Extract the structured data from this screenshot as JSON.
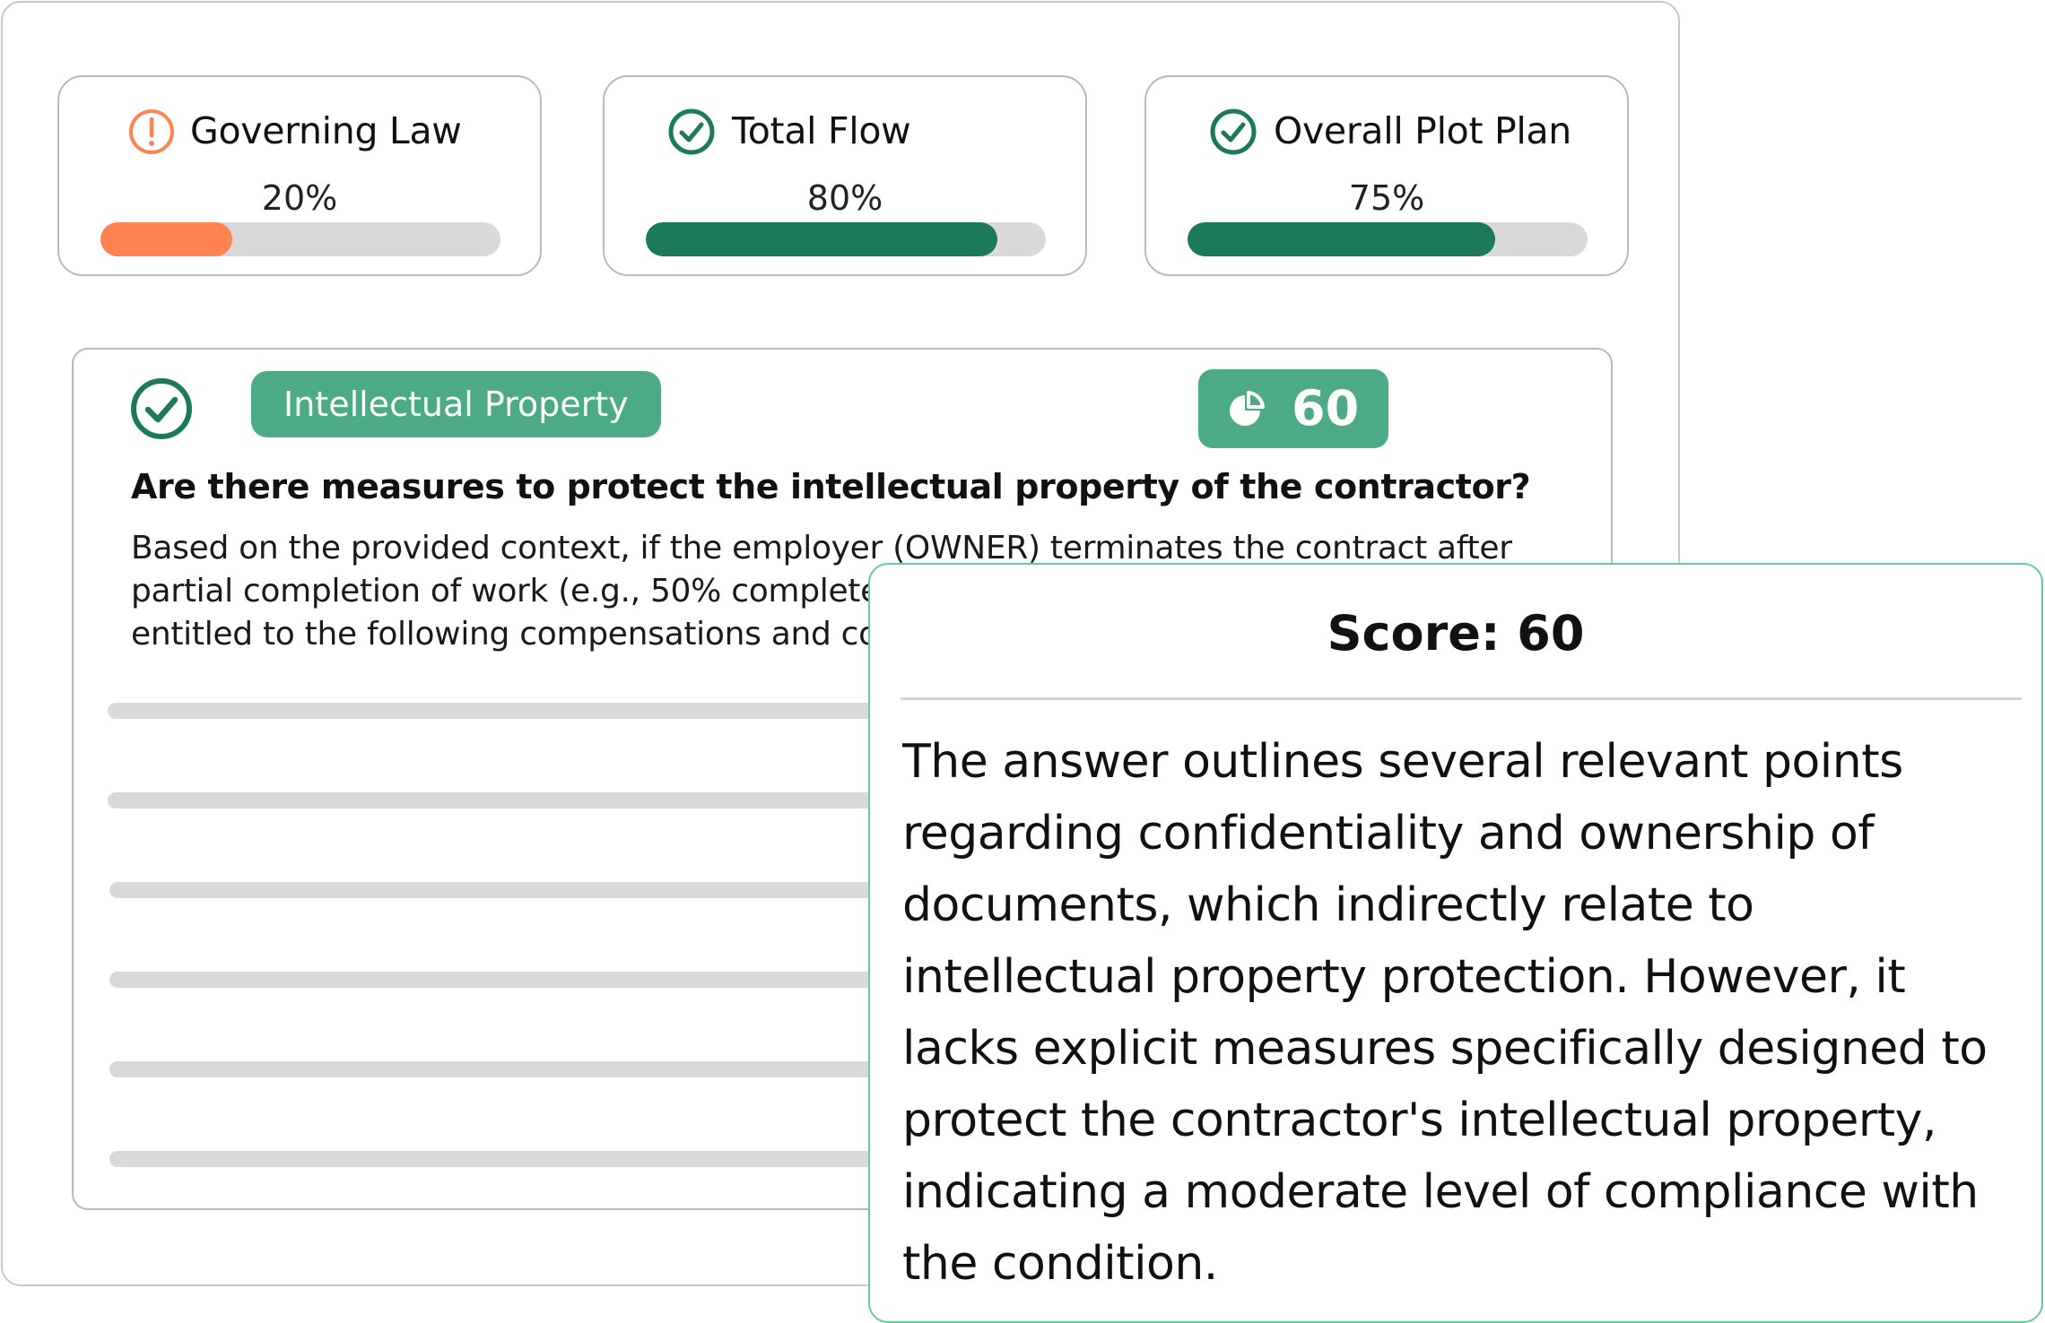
{
  "metrics": [
    {
      "label": "Governing Law",
      "value_text": "20%",
      "progress": 0.33,
      "status": "warning",
      "icon": "alert-circle-icon",
      "color": "#ff8352"
    },
    {
      "label": "Total Flow",
      "value_text": "80%",
      "progress": 0.88,
      "status": "ok",
      "icon": "check-circle-icon",
      "color": "#1c7a5a"
    },
    {
      "label": "Overall Plot Plan",
      "value_text": "75%",
      "progress": 0.77,
      "status": "ok",
      "icon": "check-circle-icon",
      "color": "#1c7a5a"
    }
  ],
  "question": {
    "status_icon": "check-circle-icon",
    "tag": "Intellectual Property",
    "score": "60",
    "score_icon": "pie-chart-icon",
    "title": "Are there measures to protect the intellectual property of the contractor?",
    "body_lines": [
      "Based on the provided context, if the employer (OWNER) terminates the contract after",
      "partial completion of work (e.g., 50% completed",
      "entitled to the following compensations and co"
    ]
  },
  "score_panel": {
    "title": "Score: 60",
    "explanation_lines": [
      "The answer outlines several relevant points",
      "regarding confidentiality and ownership of",
      "documents, which indirectly relate to",
      "intellectual property protection. However, it",
      "lacks explicit measures specifically designed to",
      "protect the contractor's intellectual property,",
      "indicating a moderate level of compliance with",
      "the condition."
    ]
  },
  "colors": {
    "accent_green": "#4caa84",
    "dark_green": "#1c7a5a",
    "warning_orange": "#ff8352",
    "track_gray": "#d9d9d9",
    "panel_border_green": "#69c99a"
  }
}
